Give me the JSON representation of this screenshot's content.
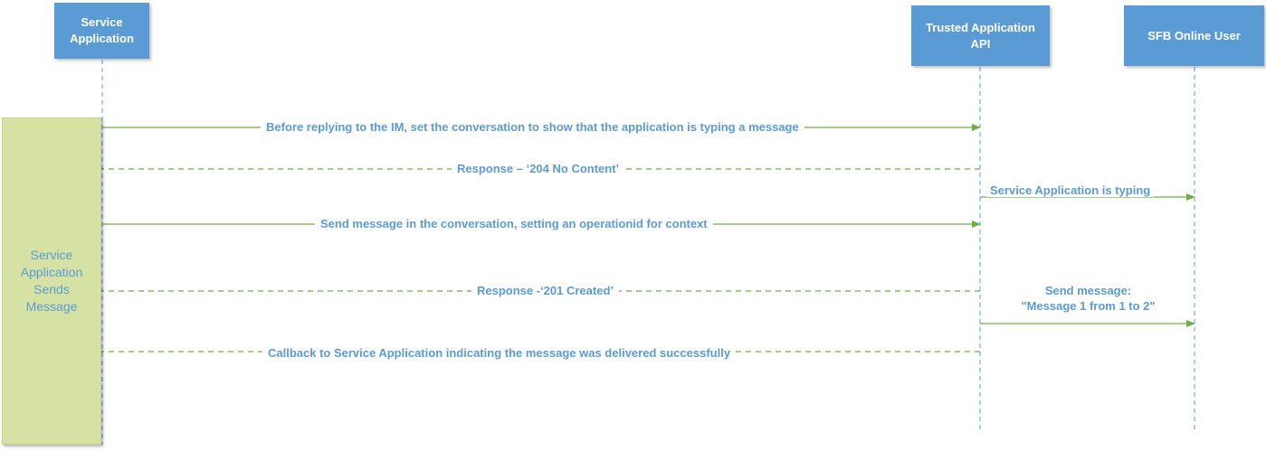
{
  "actors": [
    {
      "label": "Service\nApplication"
    },
    {
      "label": "Trusted Application\nAPI"
    },
    {
      "label": "SFB Online User"
    }
  ],
  "activation": {
    "label": "Service\nApplication\nSends\nMessage"
  },
  "messages": [
    {
      "label": "Before replying to the IM, set the conversation to show that the application is typing a message",
      "style": "solid",
      "from": "Service Application",
      "to": "Trusted Application API"
    },
    {
      "label": "Response – ‘204 No Content’",
      "style": "dashed",
      "from": "Trusted Application API",
      "to": "Service Application"
    },
    {
      "label": "Service Application is typing",
      "style": "solid",
      "from": "Trusted Application API",
      "to": "SFB Online User"
    },
    {
      "label": "Send message in the conversation, setting an operationid for context",
      "style": "solid",
      "from": "Service Application",
      "to": "Trusted Application API"
    },
    {
      "label": "Response -‘201 Created’",
      "style": "dashed",
      "from": "Trusted Application API",
      "to": "Service Application"
    },
    {
      "label": "Send message:\n\"Message 1 from 1 to 2\"",
      "style": "solid",
      "from": "Trusted Application API",
      "to": "SFB Online User"
    },
    {
      "label": "Callback to Service Application indicating the message was delivered successfully",
      "style": "dashed",
      "from": "Trusted Application API",
      "to": "Service Application"
    }
  ],
  "colors": {
    "actor": "#5b9bd5",
    "activation": "#d6e2a3",
    "arrow": "#70ad47",
    "lifeline": "#5b9bd5",
    "text": "#5b9bd5"
  }
}
